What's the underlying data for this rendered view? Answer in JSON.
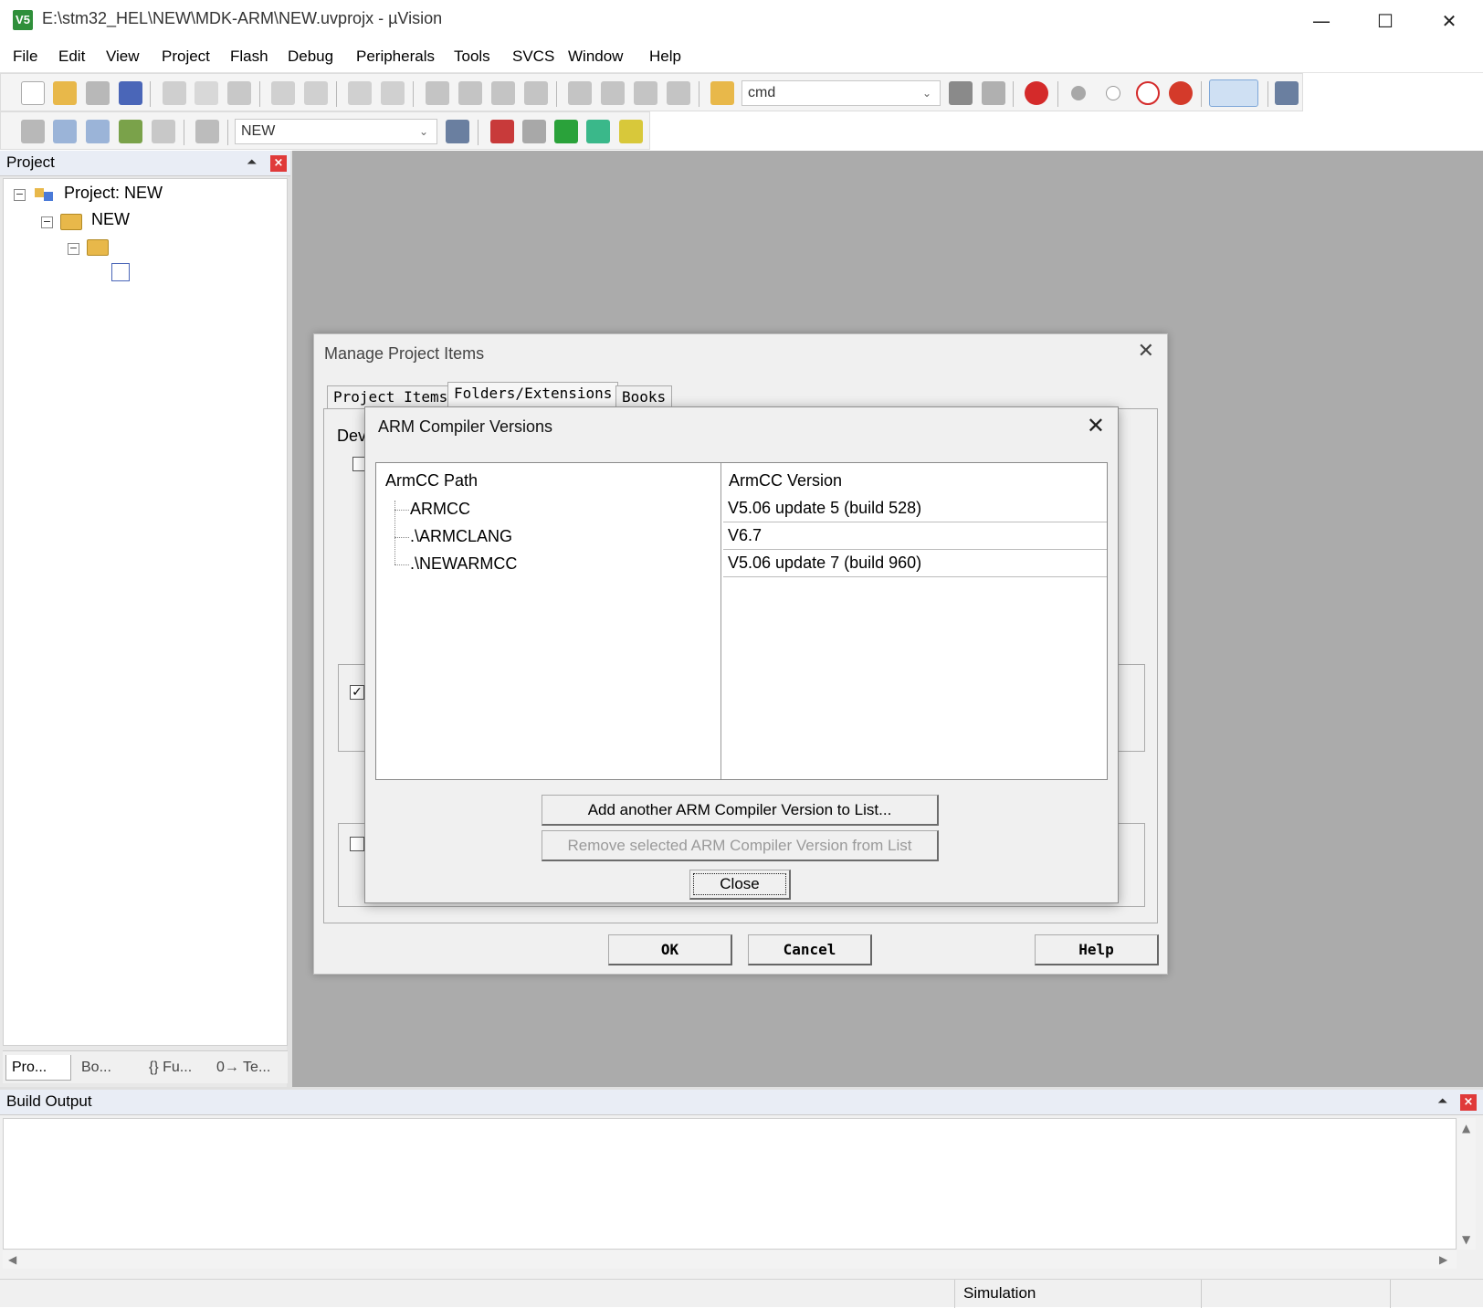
{
  "window": {
    "title": "E:\\stm32_HEL\\NEW\\MDK-ARM\\NEW.uvprojx - µVision",
    "app_icon_text": "V5"
  },
  "menu": [
    "File",
    "Edit",
    "View",
    "Project",
    "Flash",
    "Debug",
    "Peripherals",
    "Tools",
    "SVCS",
    "Window",
    "Help"
  ],
  "toolbar": {
    "find_combo_value": "cmd",
    "target_combo_value": "NEW"
  },
  "project_pane": {
    "title": "Project",
    "tree": {
      "root": "Project: NEW",
      "target": "NEW"
    },
    "tabs": [
      "Pro...",
      "Bo...",
      "{} Fu...",
      "0→ Te..."
    ]
  },
  "build_output": {
    "title": "Build Output"
  },
  "statusbar": {
    "mode": "Simulation"
  },
  "manage_dialog": {
    "title": "Manage Project Items",
    "tabs": [
      "Project Items",
      "Folders/Extensions",
      "Books"
    ],
    "partial_label": "Dev",
    "buttons": {
      "ok": "OK",
      "cancel": "Cancel",
      "help": "Help"
    }
  },
  "arm_dialog": {
    "title": "ARM Compiler Versions",
    "columns": [
      "ArmCC Path",
      "ArmCC Version"
    ],
    "rows": [
      {
        "path": "ARMCC",
        "version": "V5.06 update 5 (build 528)"
      },
      {
        "path": ".\\ARMCLANG",
        "version": "V6.7"
      },
      {
        "path": ".\\NEWARMCC",
        "version": "V5.06 update 7 (build 960)"
      }
    ],
    "buttons": {
      "add": "Add another ARM Compiler Version to List...",
      "remove": "Remove selected ARM Compiler Version from List",
      "close": "Close"
    }
  }
}
